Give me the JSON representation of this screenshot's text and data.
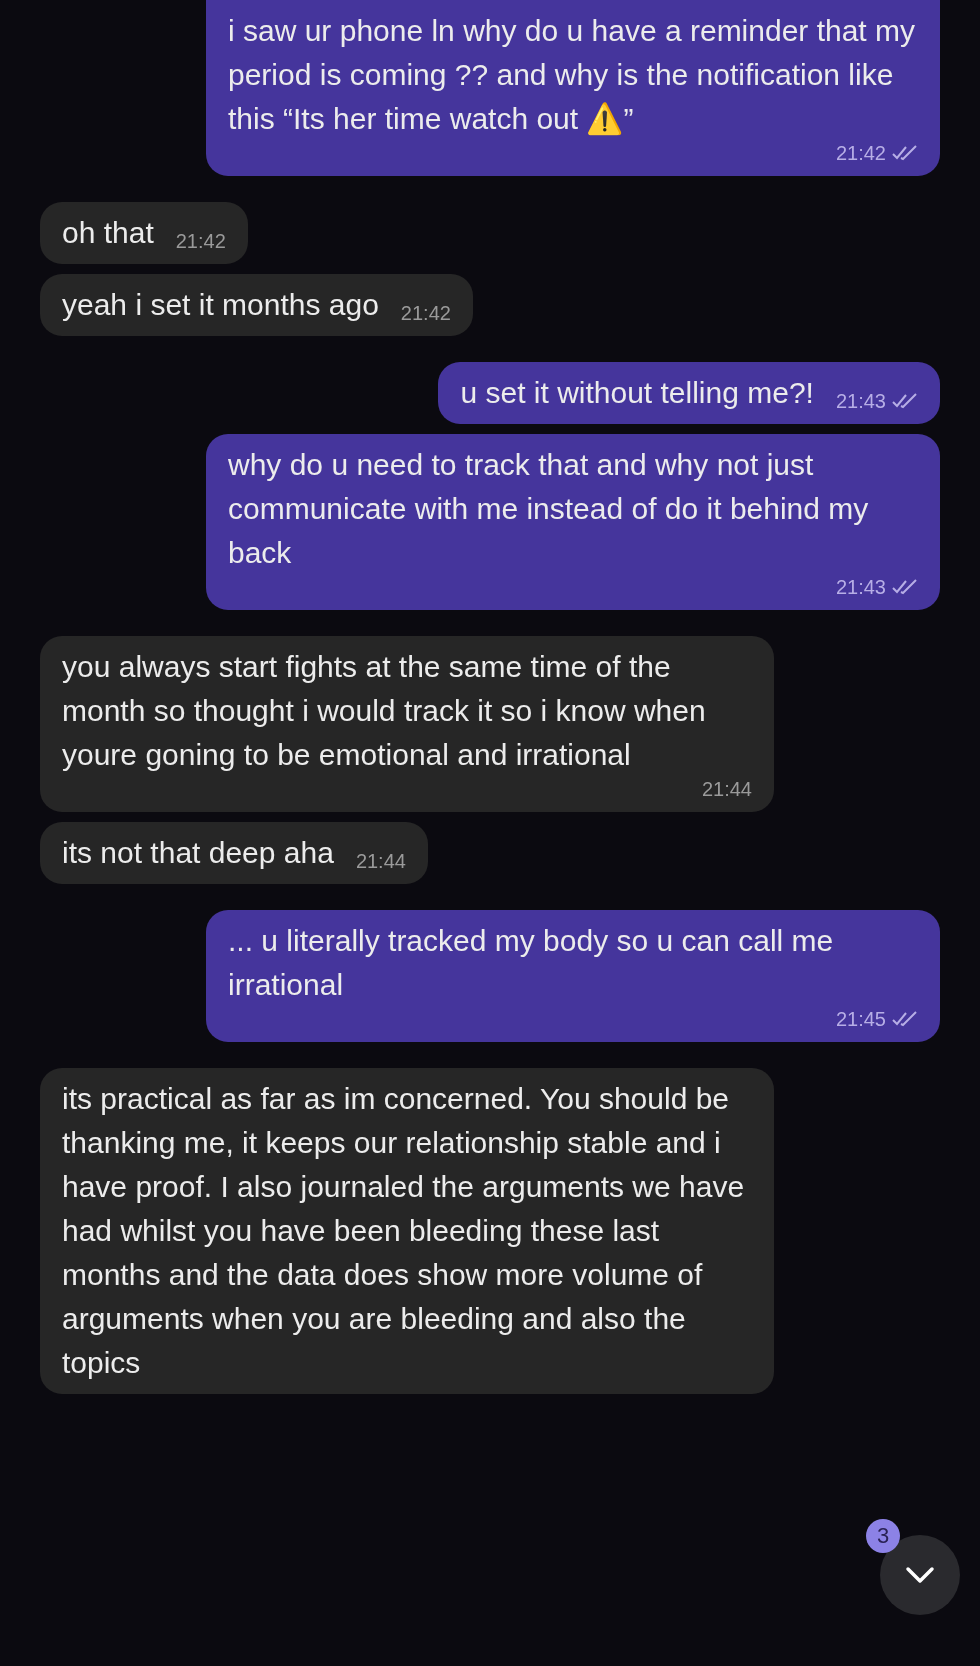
{
  "messages": [
    {
      "kind": "out",
      "text": "i saw ur phone ln why do u have a reminder that my period is coming ?? and why is the notification like this “Its her time watch out ⚠️”",
      "time": "21:42",
      "read": true
    },
    {
      "kind": "in",
      "text": "oh that",
      "time": "21:42"
    },
    {
      "kind": "in",
      "text": "yeah i set it months ago",
      "time": "21:42"
    },
    {
      "kind": "out",
      "text": "u set it without telling me?!",
      "time": "21:43",
      "read": true
    },
    {
      "kind": "out",
      "text": "why do u need to track that and why not just communicate with me instead of do it behind my back",
      "time": "21:43",
      "read": true
    },
    {
      "kind": "in",
      "text": "you always start fights at the same time of the month so thought i would track it so i know when youre goning to be emotional and irrational",
      "time": "21:44"
    },
    {
      "kind": "in",
      "text": "its not that deep aha",
      "time": "21:44"
    },
    {
      "kind": "out",
      "text": "... u literally tracked my body so u can call me irrational",
      "time": "21:45",
      "read": true
    },
    {
      "kind": "in",
      "text": "its practical as far as im concerned. You should be thanking me, it keeps our relationship stable and i have proof. I also journaled the arguments we have had whilst you have been bleeding these last months and the data does show more volume of arguments when you are bleeding and also the topics"
    }
  ],
  "scroll_button": {
    "badge": "3"
  }
}
